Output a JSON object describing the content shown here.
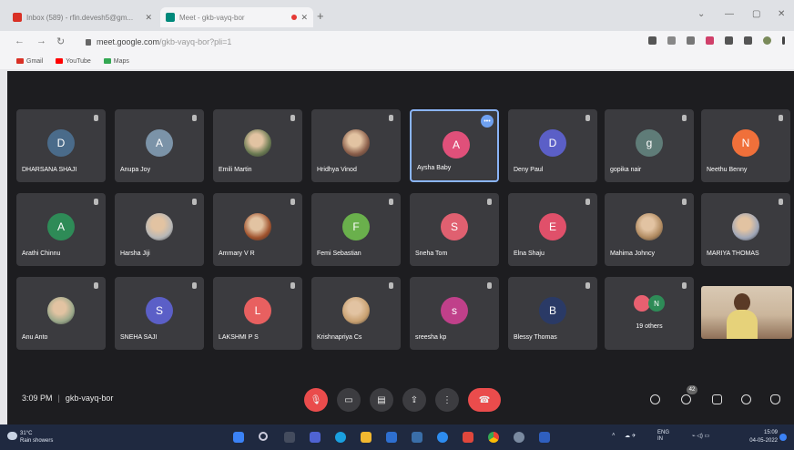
{
  "browser": {
    "tabs": [
      {
        "title": "Inbox (589) - rfin.devesh5@gm...",
        "active": false
      },
      {
        "title": "Meet - gkb-vayq-bor",
        "active": true
      }
    ],
    "new_tab_label": "+",
    "window_controls": [
      "⌄",
      "—",
      "▢",
      "✕"
    ],
    "url_main": "meet.google.com",
    "url_path": "/gkb-vayq-bor?pli=1",
    "bookmarks": [
      {
        "label": "Gmail",
        "color": "#d93025"
      },
      {
        "label": "YouTube",
        "color": "#ff0000"
      },
      {
        "label": "Maps",
        "color": "#34a853"
      }
    ]
  },
  "participants": [
    {
      "name": "DHARSANA SHAJI",
      "initial": "D",
      "color": "#4a6b8a"
    },
    {
      "name": "Anupa Joy",
      "initial": "A",
      "color": "#7b93a8"
    },
    {
      "name": "Emili Martin",
      "initial": "",
      "color": "#6a7a52",
      "photo": true
    },
    {
      "name": "Hridhya Vinod",
      "initial": "",
      "color": "#8a5e4a",
      "photo": true
    },
    {
      "name": "Aysha Baby",
      "initial": "A",
      "color": "#e0507a",
      "highlight": true
    },
    {
      "name": "Deny Paul",
      "initial": "D",
      "color": "#5b5fc7"
    },
    {
      "name": "gopika nair",
      "initial": "g",
      "color": "#5f7c78"
    },
    {
      "name": "Neethu Benny",
      "initial": "N",
      "color": "#f0703a"
    },
    {
      "name": "Arathi Chinnu",
      "initial": "A",
      "color": "#2e8b57"
    },
    {
      "name": "Harsha Jiji",
      "initial": "",
      "color": "#b7b7b7",
      "photo": true
    },
    {
      "name": "Ammary V R",
      "initial": "",
      "color": "#a0522d",
      "photo": true
    },
    {
      "name": "Femi Sebastian",
      "initial": "F",
      "color": "#6ab04c"
    },
    {
      "name": "Sneha Tom",
      "initial": "S",
      "color": "#e06070"
    },
    {
      "name": "Elna Shaju",
      "initial": "E",
      "color": "#e0506a"
    },
    {
      "name": "Mahima Johncy",
      "initial": "",
      "color": "#b08a60",
      "photo": true
    },
    {
      "name": "MARIYA THOMAS",
      "initial": "",
      "color": "#a0a7b8",
      "photo": true
    },
    {
      "name": "Anu Anto",
      "initial": "",
      "color": "#9aa88a",
      "photo": true
    },
    {
      "name": "SNEHA SAJI",
      "initial": "S",
      "color": "#5b5fc7"
    },
    {
      "name": "LAKSHMI P S",
      "initial": "L",
      "color": "#e86060"
    },
    {
      "name": "Krishnapriya Cs",
      "initial": "",
      "color": "#c8a070",
      "photo": true
    },
    {
      "name": "sreesha kp",
      "initial": "s",
      "color": "#c0408a"
    },
    {
      "name": "Blessy Thomas",
      "initial": "B",
      "color": "#2a3a66"
    }
  ],
  "others": {
    "label": "19 others",
    "minis": [
      {
        "initial": "",
        "color": "#e86070"
      },
      {
        "initial": "N",
        "color": "#2e8b57"
      }
    ]
  },
  "more_badge": "•••",
  "meeting": {
    "time": "3:09 PM",
    "code": "gkb-vayq-bor"
  },
  "people_count": "42",
  "taskbar": {
    "weather_temp": "31°C",
    "weather_desc": "Rain showers",
    "lang": "ENG",
    "region": "IN",
    "time": "15:09",
    "date": "04-05-2022"
  }
}
